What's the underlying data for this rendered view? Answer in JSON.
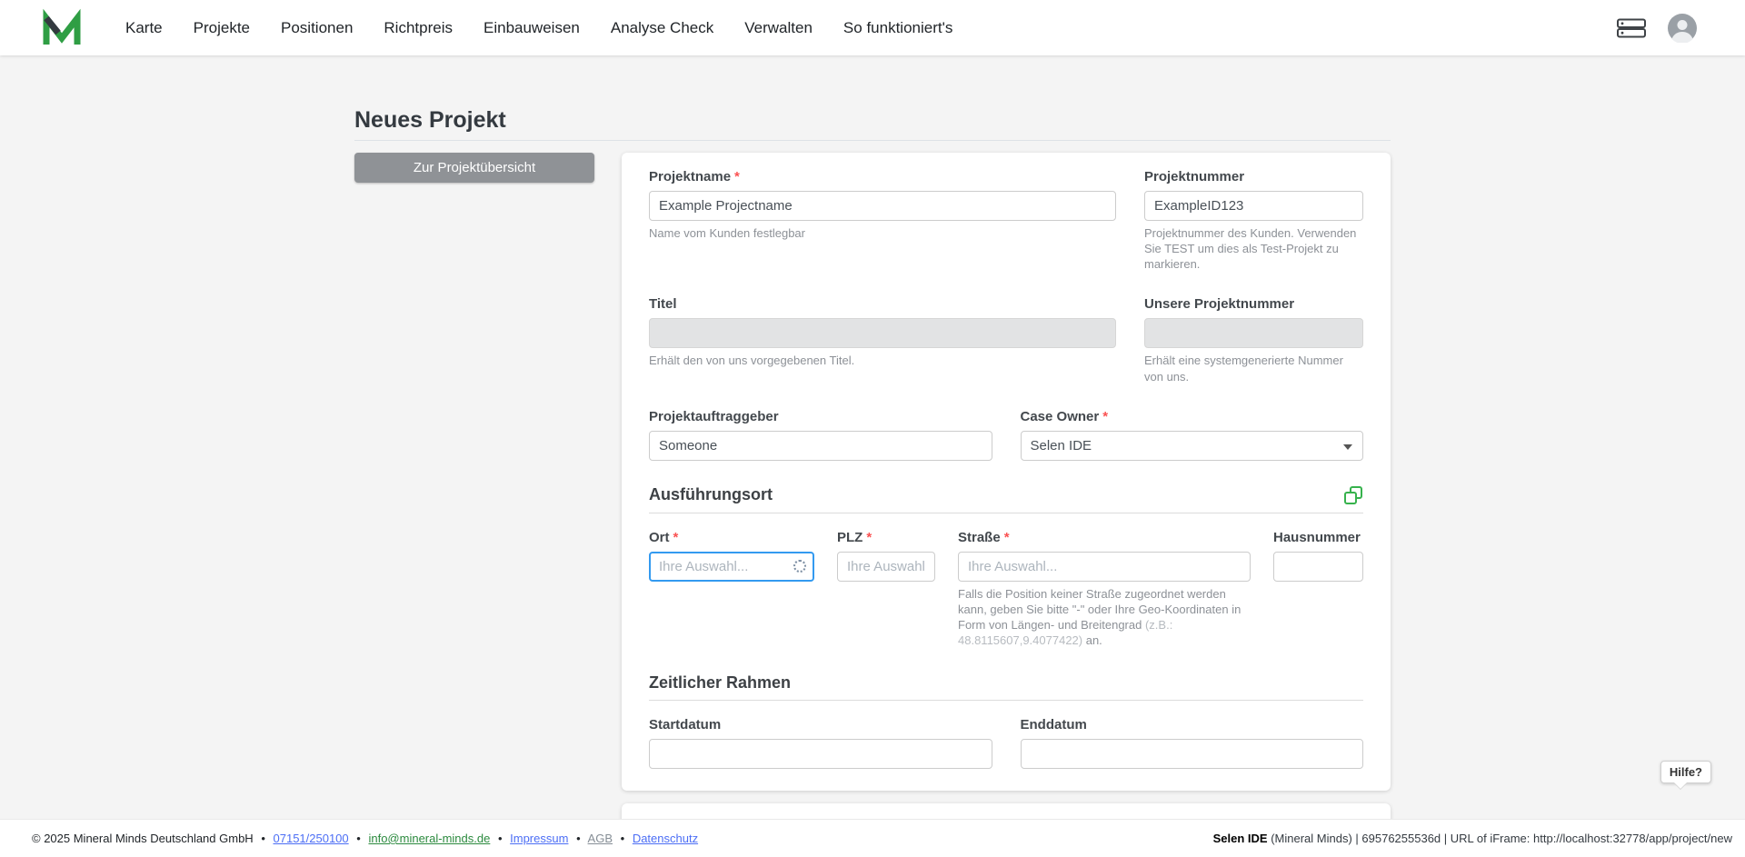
{
  "nav": {
    "items": [
      {
        "label": "Karte"
      },
      {
        "label": "Projekte"
      },
      {
        "label": "Positionen"
      },
      {
        "label": "Richtpreis"
      },
      {
        "label": "Einbauweisen"
      },
      {
        "label": "Analyse Check"
      },
      {
        "label": "Verwalten"
      },
      {
        "label": "So funktioniert's"
      }
    ]
  },
  "page": {
    "title": "Neues Projekt",
    "back_button_label": "Zur Projektübersicht"
  },
  "ui": {
    "required_marker": "*"
  },
  "form": {
    "projektname": {
      "label": "Projektname",
      "value": "Example Projectname",
      "helper": "Name vom Kunden festlegbar"
    },
    "projektnummer": {
      "label": "Projektnummer",
      "value": "ExampleID123",
      "helper": "Projektnummer des Kunden. Verwenden Sie TEST um dies als Test-Projekt zu markieren."
    },
    "titel": {
      "label": "Titel",
      "helper": "Erhält den von uns vorgegebenen Titel."
    },
    "unsere_projektnummer": {
      "label": "Unsere Projektnummer",
      "helper": "Erhält eine systemgenerierte Nummer von uns."
    },
    "projektauftraggeber": {
      "label": "Projektauftraggeber",
      "value": "Someone"
    },
    "case_owner": {
      "label": "Case Owner",
      "value": "Selen IDE"
    },
    "sections": {
      "ausfuehrungsort": "Ausführungsort",
      "zeitlicher_rahmen": "Zeitlicher Rahmen"
    },
    "ort": {
      "label": "Ort",
      "placeholder": "Ihre Auswahl..."
    },
    "plz": {
      "label": "PLZ",
      "placeholder": "Ihre Auswahl."
    },
    "strasse": {
      "label": "Straße",
      "placeholder": "Ihre Auswahl...",
      "helper_text": "Falls die Position keiner Straße zugeordnet werden kann, geben Sie bitte \"-\" oder Ihre Geo-Koordinaten in Form von Längen- und Breitengrad ",
      "helper_example": "(z.B.: 48.8115607,9.4077422)",
      "helper_suffix": " an."
    },
    "hausnummer": {
      "label": "Hausnummer"
    },
    "startdatum": {
      "label": "Startdatum"
    },
    "enddatum": {
      "label": "Enddatum"
    }
  },
  "help": {
    "label": "Hilfe?"
  },
  "footer": {
    "copyright": "© 2025 Mineral Minds Deutschland GmbH",
    "separator": "•",
    "phone": "07151/250100",
    "email": "info@mineral-minds.de",
    "impressum": "Impressum",
    "agb": "AGB",
    "datenschutz": "Datenschutz",
    "session_user": "Selen IDE",
    "session_rest": " (Mineral Minds) | 69576255536d | URL of iFrame: http://localhost:32778/app/project/new"
  },
  "icons": {
    "logo": "mineral-minds-logo",
    "nav_right": [
      "server-icon",
      "user-avatar"
    ],
    "section": "copy-icon",
    "select": "caret-down-icon",
    "loading": "spinner-icon"
  },
  "colors": {
    "brand_green": "#2f9e44",
    "focus_blue": "#339af0",
    "required_red": "#fa5252",
    "disabled_gray": "#e2e3e4"
  }
}
